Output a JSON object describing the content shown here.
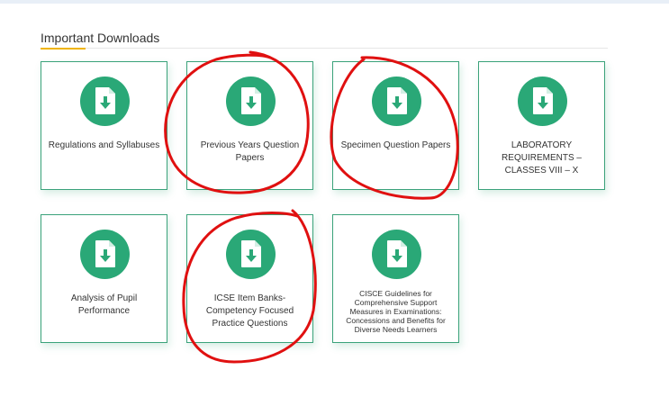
{
  "section": {
    "title": "Important Downloads"
  },
  "cards": [
    {
      "label": "Regulations and Syllabuses",
      "icon": "file-download-icon"
    },
    {
      "label": "Previous Years Question Papers",
      "icon": "file-download-icon"
    },
    {
      "label": "Specimen Question Papers",
      "icon": "file-download-icon"
    },
    {
      "label": "LABORATORY REQUIREMENTS – CLASSES VIII – X",
      "icon": "file-download-icon"
    },
    {
      "label": "Analysis of Pupil Performance",
      "icon": "file-download-icon"
    },
    {
      "label": "ICSE Item Banks- Competency Focused Practice Questions",
      "icon": "file-download-icon"
    },
    {
      "label": "CISCE Guidelines for Comprehensive Support Measures in Examinations: Concessions and Benefits for Diverse Needs Learners",
      "icon": "file-download-icon"
    }
  ],
  "colors": {
    "card_border": "#3aa27a",
    "icon_bg": "#2aa877",
    "accent_underline": "#f0b400",
    "annotation_red": "#e01010"
  }
}
